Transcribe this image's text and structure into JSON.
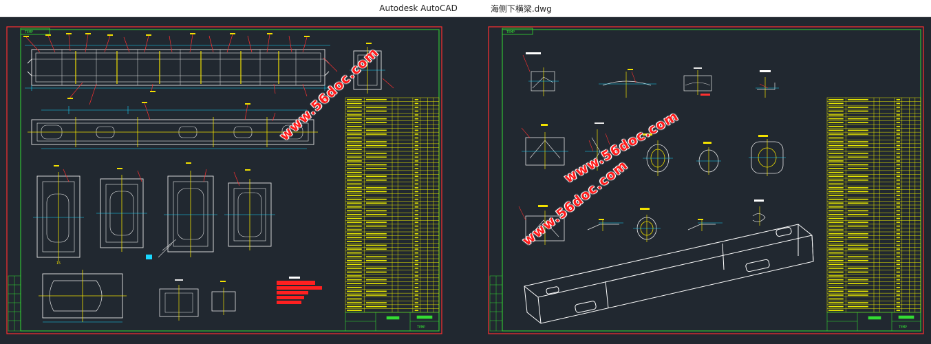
{
  "app": {
    "name": "Autodesk AutoCAD",
    "file": "海侧下横梁.dwg"
  },
  "sheets": [
    {
      "id": "left",
      "label": "TEMP"
    },
    {
      "id": "right",
      "label": "TEMP"
    }
  ],
  "title_block": {
    "label": "TEMP"
  },
  "section_label": "15",
  "watermark": {
    "text": "www.56doc.com"
  },
  "colors": {
    "canvas": "#212830",
    "frame": "#ff3030",
    "border": "#33dd33",
    "table": "#e8e800",
    "part": "#e8e8e8",
    "dimension": "#19d8ff",
    "leader": "#ff3030",
    "marker": "#f2e100"
  }
}
